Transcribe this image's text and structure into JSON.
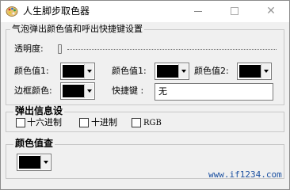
{
  "window": {
    "title": "人生脚步取色器",
    "icon": "palette-icon",
    "controls": {
      "minimize": "minimize-icon",
      "maximize": "maximize-icon",
      "close": "close-icon"
    }
  },
  "main_group": {
    "title": "气泡弹出颜色值和呼出快捷键设置",
    "transparency_label": "透明度:",
    "transparency_level": 0,
    "color_value_1_label": "颜色值1:",
    "color_value_1": "#000000",
    "color_value_2a_label": "颜色值1:",
    "color_value_2a": "#000000",
    "color_value_2b_label": "颜色值2:",
    "color_value_2b": "#000000",
    "border_color_label": "边框颜色:",
    "border_color": "#000000",
    "hotkey_label": "快捷键 :",
    "hotkey_value": "无"
  },
  "popup_group": {
    "title": "弹出信息设",
    "options": [
      {
        "label": "十六进制",
        "checked": false
      },
      {
        "label": "十进制",
        "checked": false
      },
      {
        "label": "RGB",
        "checked": false
      }
    ]
  },
  "color_query_group": {
    "title": "颜色值查",
    "color": "#000000"
  },
  "footer": {
    "text": "www.if1234.com"
  }
}
